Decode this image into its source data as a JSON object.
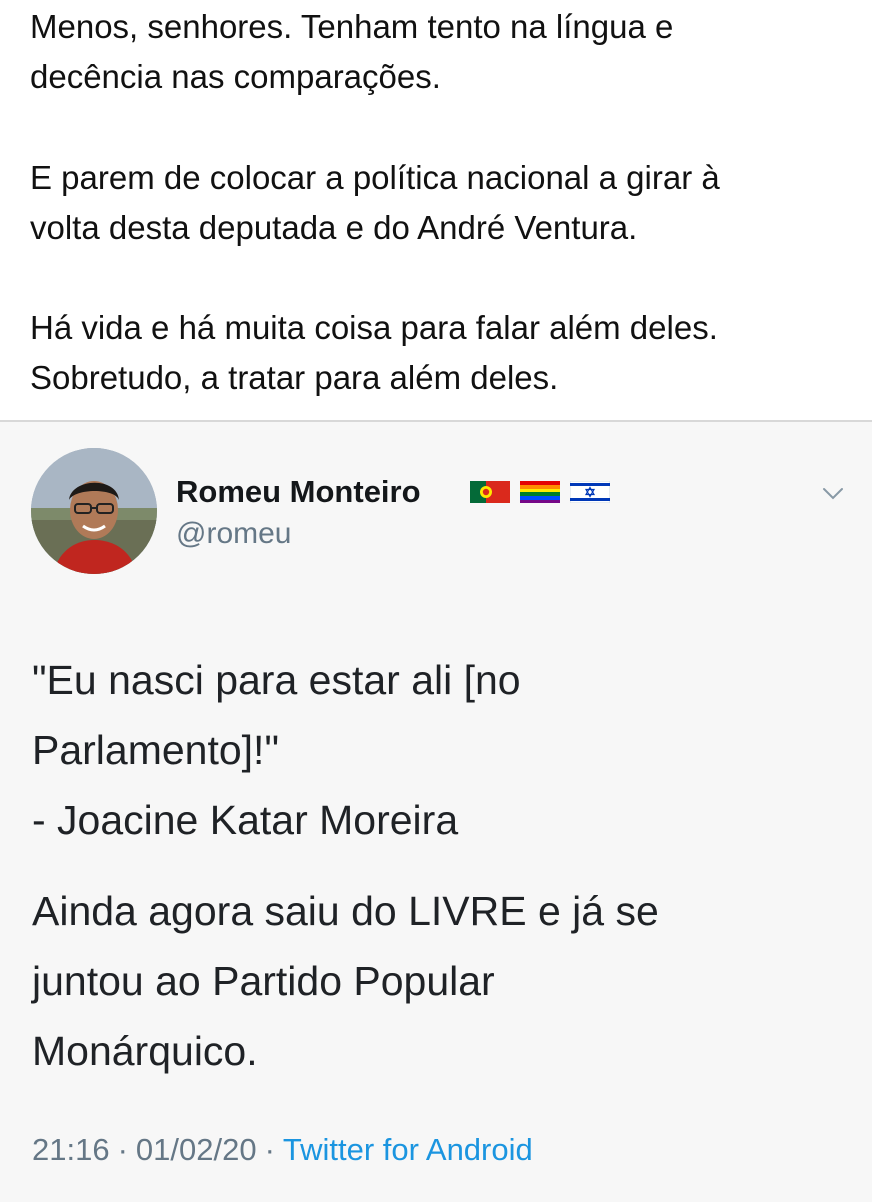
{
  "post": {
    "paragraphs": [
      [
        "Menos, senhores. Tenham tento na língua e",
        "decência nas comparações."
      ],
      [
        "E parem de colocar a política nacional a girar à",
        "volta desta deputada e do André Ventura."
      ],
      [
        "Há vida e há muita coisa para falar além deles.",
        "Sobretudo, a tratar para além deles."
      ]
    ]
  },
  "tweet": {
    "author": {
      "name": "Romeu Monteiro",
      "handle": "@romeu",
      "flags": [
        "portugal-flag-icon",
        "rainbow-flag-icon",
        "israel-flag-icon"
      ]
    },
    "quote_lines": [
      "\"Eu nasci para estar ali [no",
      "Parlamento]!\"",
      "- Joacine Katar Moreira"
    ],
    "comment_lines": [
      "Ainda agora saiu do LIVRE e já se",
      "juntou ao Partido Popular",
      "Monárquico."
    ],
    "time": "21:16",
    "separator": "·",
    "date": "01/02/20",
    "client": "Twitter for Android"
  },
  "colors": {
    "client_link": "#1b95e0",
    "meta_text": "#657786",
    "card_bg": "#f7f7f7"
  }
}
